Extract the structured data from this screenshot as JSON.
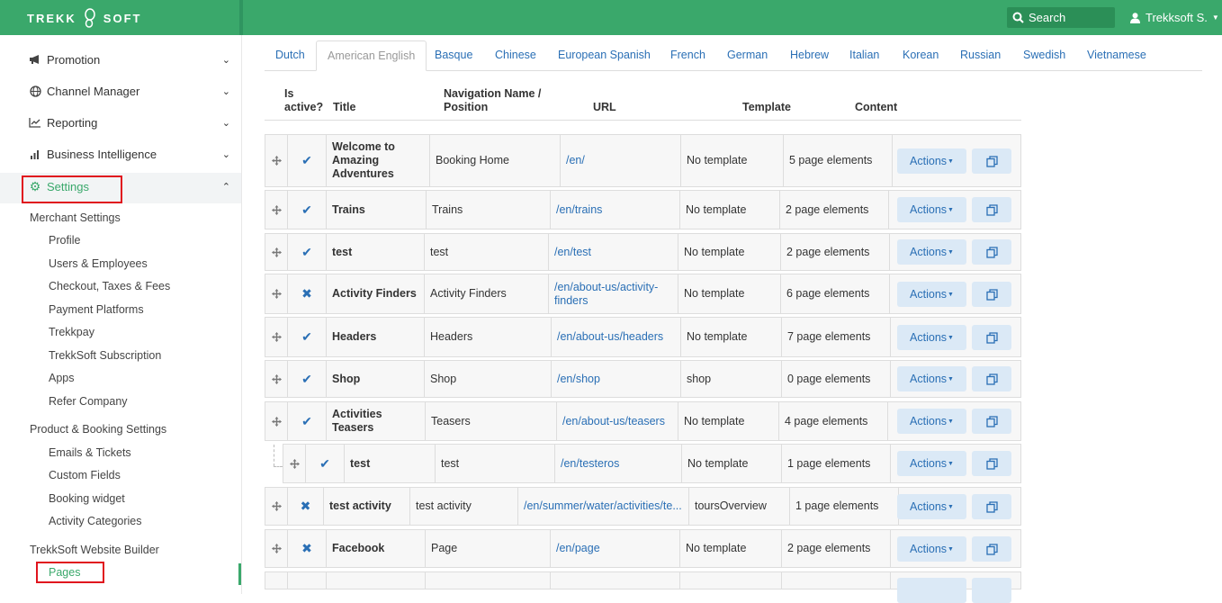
{
  "header": {
    "logo_left": "TREKK",
    "logo_right": "SOFT",
    "search_label": "Search",
    "user_name": "Trekksoft S."
  },
  "sidebar": {
    "menu": [
      {
        "label": "Promotion",
        "icon": "megaphone-icon"
      },
      {
        "label": "Channel Manager",
        "icon": "globe-icon"
      },
      {
        "label": "Reporting",
        "icon": "line-chart-icon"
      },
      {
        "label": "Business Intelligence",
        "icon": "bar-chart-icon"
      },
      {
        "label": "Settings",
        "icon": "gear-icon"
      }
    ],
    "merchant_group": "Merchant Settings",
    "merchant_items": [
      "Profile",
      "Users & Employees",
      "Checkout, Taxes & Fees",
      "Payment Platforms",
      "Trekkpay",
      "TrekkSoft Subscription",
      "Apps",
      "Refer Company"
    ],
    "product_group": "Product & Booking Settings",
    "product_items": [
      "Emails & Tickets",
      "Custom Fields",
      "Booking widget",
      "Activity Categories"
    ],
    "website_group": "TrekkSoft Website Builder",
    "website_items": [
      "Pages"
    ]
  },
  "tabs": [
    "Dutch",
    "American English",
    "Basque",
    "Chinese",
    "European Spanish",
    "French",
    "German",
    "Hebrew",
    "Italian",
    "Korean",
    "Russian",
    "Swedish",
    "Vietnamese"
  ],
  "active_tab": "American English",
  "table": {
    "headers": {
      "active_line1": "Is",
      "active_line2": "active?",
      "title": "Title",
      "nav_line1": "Navigation Name /",
      "nav_line2": "Position",
      "url": "URL",
      "template": "Template",
      "content": "Content"
    },
    "actions_label": "Actions",
    "rows": [
      {
        "active": true,
        "title": "Welcome to Amazing Adventures",
        "nav": "Booking Home",
        "url": "/en/",
        "template": "No template",
        "content": "5 page elements"
      },
      {
        "active": true,
        "title": "Trains",
        "nav": "Trains",
        "url": "/en/trains",
        "template": "No template",
        "content": "2 page elements"
      },
      {
        "active": true,
        "title": "test",
        "nav": "test",
        "url": "/en/test",
        "template": "No template",
        "content": "2 page elements"
      },
      {
        "active": false,
        "title": "Activity Finders",
        "nav": "Activity Finders",
        "url": "/en/about-us/activity-finders",
        "template": "No template",
        "content": "6 page elements"
      },
      {
        "active": true,
        "title": "Headers",
        "nav": "Headers",
        "url": "/en/about-us/headers",
        "template": "No template",
        "content": "7 page elements"
      },
      {
        "active": true,
        "title": "Shop",
        "nav": "Shop",
        "url": "/en/shop",
        "template": "shop",
        "content": "0 page elements"
      },
      {
        "active": true,
        "title": "Activities Teasers",
        "nav": "Teasers",
        "url": "/en/about-us/teasers",
        "template": "No template",
        "content": "4 page elements"
      },
      {
        "active": true,
        "title": "test",
        "nav": "test",
        "url": "/en/testeros",
        "template": "No template",
        "content": "1 page elements"
      },
      {
        "active": false,
        "title": "test activity",
        "nav": "test activity",
        "url": "/en/summer/water/activities/te...",
        "template": "toursOverview",
        "content": "1 page elements"
      },
      {
        "active": false,
        "title": "Facebook",
        "nav": "Page",
        "url": "/en/page",
        "template": "No template",
        "content": "2 page elements"
      }
    ]
  },
  "colors": {
    "brand_green": "#3aa86b",
    "link_blue": "#2a6fb5",
    "highlight_red": "#e0141e"
  }
}
